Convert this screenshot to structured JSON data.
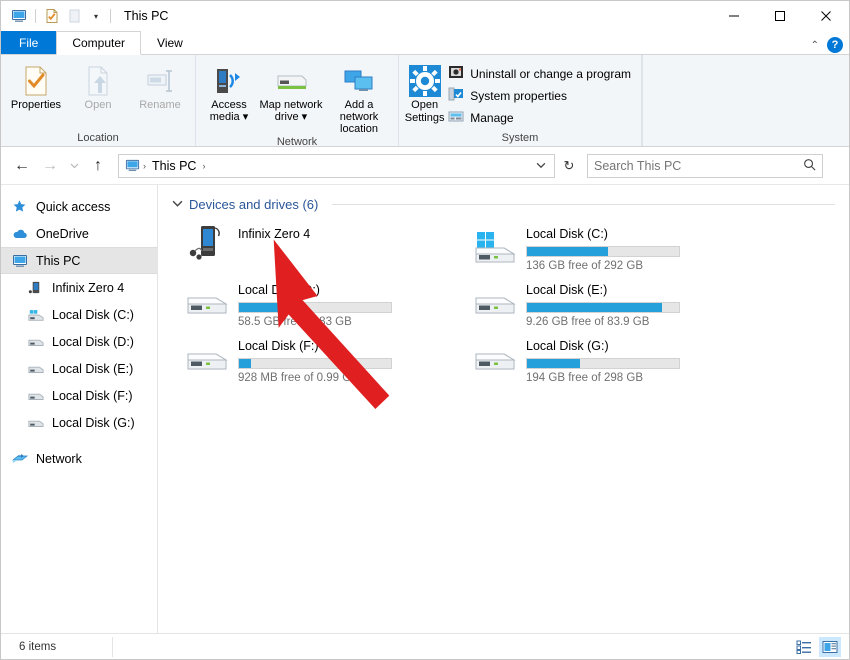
{
  "window": {
    "title": "This PC",
    "minimize_label": "—",
    "maximize_label": "☐",
    "close_label": "✕"
  },
  "quick_access_toolbar": {
    "items": [
      {
        "name": "this-pc-icon",
        "label": ""
      },
      {
        "name": "properties-icon",
        "label": ""
      },
      {
        "name": "new-folder-icon",
        "label": ""
      }
    ],
    "customize_caret": "▾"
  },
  "tabs": [
    {
      "id": "file",
      "label": "File"
    },
    {
      "id": "computer",
      "label": "Computer"
    },
    {
      "id": "view",
      "label": "View"
    }
  ],
  "ribbon": {
    "collapse_caret": "⌃",
    "help_label": "?",
    "groups": [
      {
        "title": "Location",
        "large_buttons": [
          {
            "label": "Properties",
            "disabled": false
          },
          {
            "label": "Open",
            "disabled": true
          },
          {
            "label": "Rename",
            "disabled": true
          }
        ]
      },
      {
        "title": "Network",
        "large_buttons": [
          {
            "label": "Access media ▾",
            "disabled": false
          },
          {
            "label": "Map network drive ▾",
            "disabled": false
          },
          {
            "label": "Add a network location",
            "disabled": false
          }
        ]
      },
      {
        "title": "System",
        "large_buttons": [
          {
            "label": "Open Settings",
            "disabled": false
          }
        ],
        "small_buttons": [
          {
            "label": "Uninstall or change a program"
          },
          {
            "label": "System properties"
          },
          {
            "label": "Manage"
          }
        ]
      }
    ]
  },
  "address_bar": {
    "back_label": "←",
    "forward_label": "→",
    "recent_label": "⌵",
    "up_label": "↑",
    "breadcrumb": {
      "icon": "this-pc-icon",
      "path": "This PC",
      "separator": "›",
      "dropdown_caret": "⌵"
    },
    "refresh_label": "↻"
  },
  "search": {
    "placeholder": "Search This PC",
    "value": "",
    "icon": "search-icon"
  },
  "sidebar": {
    "items": [
      {
        "label": "Quick access",
        "icon": "star-icon",
        "indent": false,
        "selected": false
      },
      {
        "label": "OneDrive",
        "icon": "cloud-icon",
        "indent": false,
        "selected": false
      },
      {
        "label": "This PC",
        "icon": "monitor-icon",
        "indent": false,
        "selected": true
      },
      {
        "label": "Infinix Zero 4",
        "icon": "phone-icon",
        "indent": true,
        "selected": false
      },
      {
        "label": "Local Disk (C:)",
        "icon": "windows-drive-icon",
        "indent": true,
        "selected": false
      },
      {
        "label": "Local Disk (D:)",
        "icon": "drive-icon",
        "indent": true,
        "selected": false
      },
      {
        "label": "Local Disk (E:)",
        "icon": "drive-icon",
        "indent": true,
        "selected": false
      },
      {
        "label": "Local Disk (F:)",
        "icon": "drive-icon",
        "indent": true,
        "selected": false
      },
      {
        "label": "Local Disk (G:)",
        "icon": "drive-icon",
        "indent": true,
        "selected": false
      },
      {
        "label": "Network",
        "icon": "network-icon",
        "indent": false,
        "selected": false
      }
    ]
  },
  "content": {
    "group_header": "Devices and drives (6)",
    "collapse_chevron": "∨",
    "tiles": [
      {
        "name": "Infinix Zero 4",
        "icon": "phone-device-icon",
        "has_bar": false,
        "free_text": "",
        "used_percent": 0
      },
      {
        "name": "Local Disk (C:)",
        "icon": "windows-drive-icon",
        "has_bar": true,
        "free_text": "136 GB free of 292 GB",
        "used_percent": 53
      },
      {
        "name": "Local Disk (D:)",
        "icon": "drive-icon",
        "has_bar": true,
        "free_text": "58.5 GB free of 83 GB",
        "used_percent": 30
      },
      {
        "name": "Local Disk (E:)",
        "icon": "drive-icon",
        "has_bar": true,
        "free_text": "9.26 GB free of 83.9 GB",
        "used_percent": 89
      },
      {
        "name": "Local Disk (F:)",
        "icon": "drive-icon",
        "has_bar": true,
        "free_text": "928 MB free of 0.99 GB",
        "used_percent": 8
      },
      {
        "name": "Local Disk (G:)",
        "icon": "drive-icon",
        "has_bar": true,
        "free_text": "194 GB free of 298 GB",
        "used_percent": 35
      }
    ]
  },
  "annotation": {
    "arrow_color": "#e02020",
    "name": "red-pointer-arrow"
  },
  "status_bar": {
    "item_count": "6 items",
    "view_details_icon": "details-view-icon",
    "view_large_icons_icon": "large-icons-view-icon"
  },
  "colors": {
    "accent": "#0078d7",
    "bar_fill": "#26a0da",
    "group_header": "#2a5699",
    "ribbon_bg": "#f3f6f9"
  }
}
